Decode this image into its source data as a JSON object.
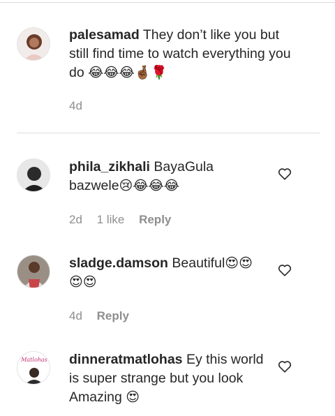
{
  "comments": [
    {
      "username": "palesamad",
      "text": "They don’t like you but still find time to watch everything you do",
      "emoji": "😂😂😂🤞🏾🌹",
      "time": "4d",
      "likes": "",
      "reply_label": "",
      "avatar_icon": "profile-photo"
    },
    {
      "username": "phila_zikhali",
      "text": "BayaGula bazwele",
      "emoji": "😢😂😂😂",
      "time": "2d",
      "likes": "1 like",
      "reply_label": "Reply",
      "avatar_icon": "profile-photo"
    },
    {
      "username": "sladge.damson",
      "text": "Beautiful",
      "emoji": "😍😍😍😍",
      "time": "4d",
      "likes": "",
      "reply_label": "Reply",
      "avatar_icon": "profile-photo"
    },
    {
      "username": "dinneratmatlohas",
      "text": "Ey this world is super strange but you look Amazing",
      "emoji": "😍",
      "time": "",
      "likes": "",
      "reply_label": "",
      "avatar_icon": "profile-photo",
      "avatar_logo_text": "Matlohas"
    }
  ],
  "icons": {
    "like": "heart-outline-icon"
  },
  "colors": {
    "text": "#262626",
    "meta": "#8e8e8e",
    "divider": "#dbdbdb"
  }
}
